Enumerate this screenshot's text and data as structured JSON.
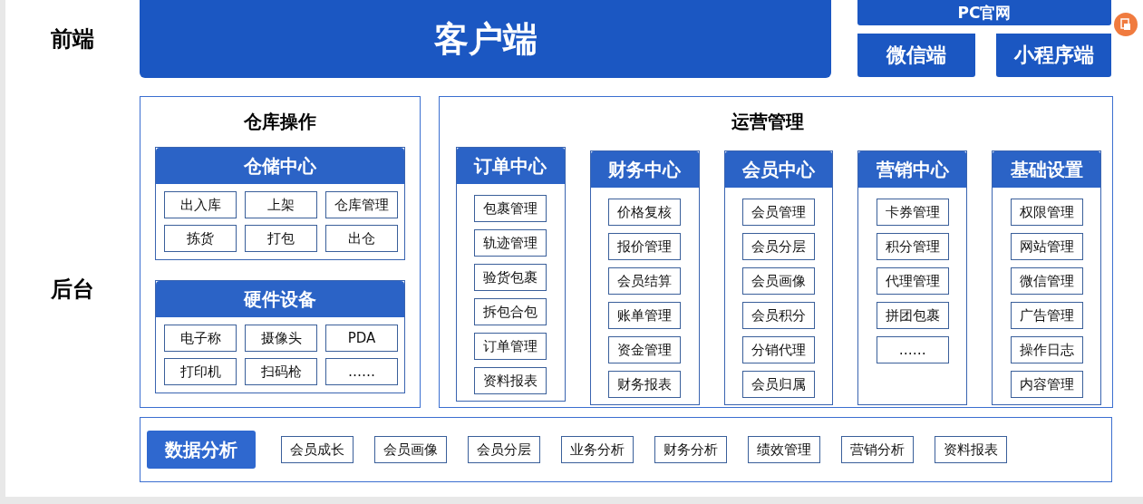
{
  "frontend": {
    "label": "前端",
    "main": "客户端",
    "channels": [
      "PC官网",
      "微信端",
      "小程序端"
    ]
  },
  "backend": {
    "label": "后台",
    "warehouse": {
      "title": "仓库操作",
      "groups": [
        {
          "title": "仓储中心",
          "items": [
            "出入库",
            "上架",
            "仓库管理",
            "拣货",
            "打包",
            "出仓"
          ]
        },
        {
          "title": "硬件设备",
          "items": [
            "电子称",
            "摄像头",
            "PDA",
            "打印机",
            "扫码枪",
            "……"
          ]
        }
      ]
    },
    "operations": {
      "title": "运营管理",
      "centers": [
        {
          "title": "订单中心",
          "items": [
            "包裹管理",
            "轨迹管理",
            "验货包裹",
            "拆包合包",
            "订单管理",
            "资料报表"
          ]
        },
        {
          "title": "财务中心",
          "items": [
            "价格复核",
            "报价管理",
            "会员结算",
            "账单管理",
            "资金管理",
            "财务报表"
          ]
        },
        {
          "title": "会员中心",
          "items": [
            "会员管理",
            "会员分层",
            "会员画像",
            "会员积分",
            "分销代理",
            "会员归属"
          ]
        },
        {
          "title": "营销中心",
          "items": [
            "卡券管理",
            "积分管理",
            "代理管理",
            "拼团包裹",
            "……"
          ]
        },
        {
          "title": "基础设置",
          "items": [
            "权限管理",
            "网站管理",
            "微信管理",
            "广告管理",
            "操作日志",
            "内容管理"
          ]
        }
      ]
    },
    "analytics": {
      "title": "数据分析",
      "items": [
        "会员成长",
        "会员画像",
        "会员分层",
        "业务分析",
        "财务分析",
        "绩效管理",
        "营销分析",
        "资料报表"
      ]
    }
  }
}
